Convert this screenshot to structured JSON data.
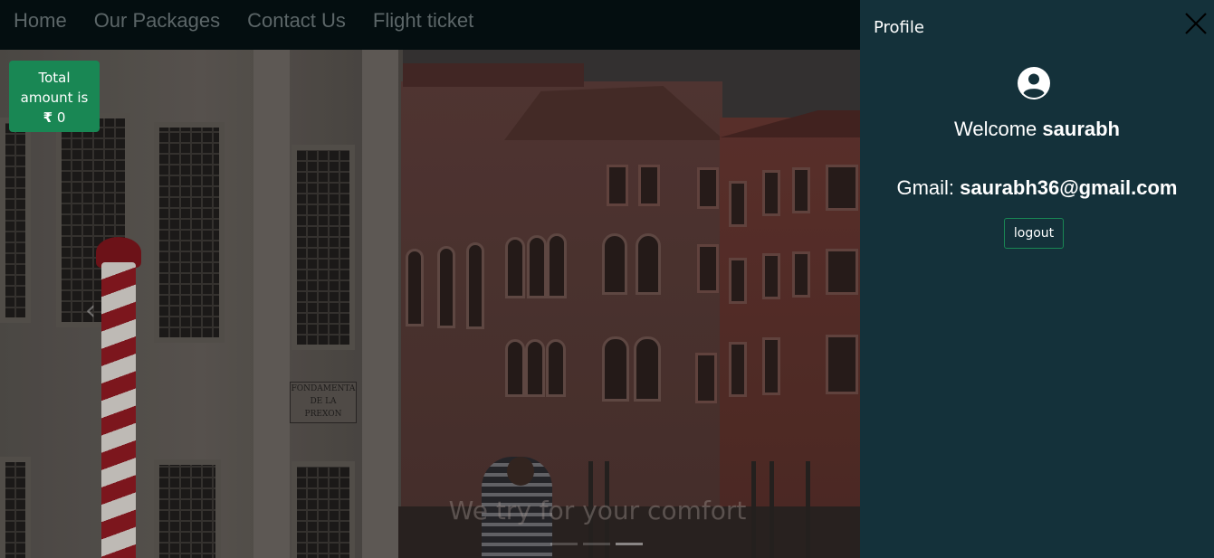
{
  "nav": {
    "items": [
      {
        "label": "Home"
      },
      {
        "label": "Our Packages"
      },
      {
        "label": "Contact Us"
      },
      {
        "label": "Flight ticket"
      }
    ]
  },
  "total": {
    "line1": "Total",
    "line2": "amount is",
    "currency": "₹",
    "amount": "0"
  },
  "hero": {
    "caption": "We try for your comfort",
    "prev_icon": "chevron-left-icon",
    "plaque_text": "FONDAMENTA DE LA PREXON",
    "indicators": [
      {
        "active": false
      },
      {
        "active": false
      },
      {
        "active": true
      }
    ]
  },
  "profile": {
    "title": "Profile",
    "close_icon": "close-icon",
    "avatar_icon": "user-circle-icon",
    "welcome_prefix": "Welcome",
    "username": "saurabh",
    "gmail_prefix": "Gmail:",
    "email": "saurabh36@gmail.com",
    "logout_label": "logout"
  },
  "colors": {
    "nav_bg": "#040e10",
    "nav_text": "#5c6668",
    "badge_bg": "#198754",
    "panel_bg": "#14313a",
    "button_border": "#198754"
  }
}
